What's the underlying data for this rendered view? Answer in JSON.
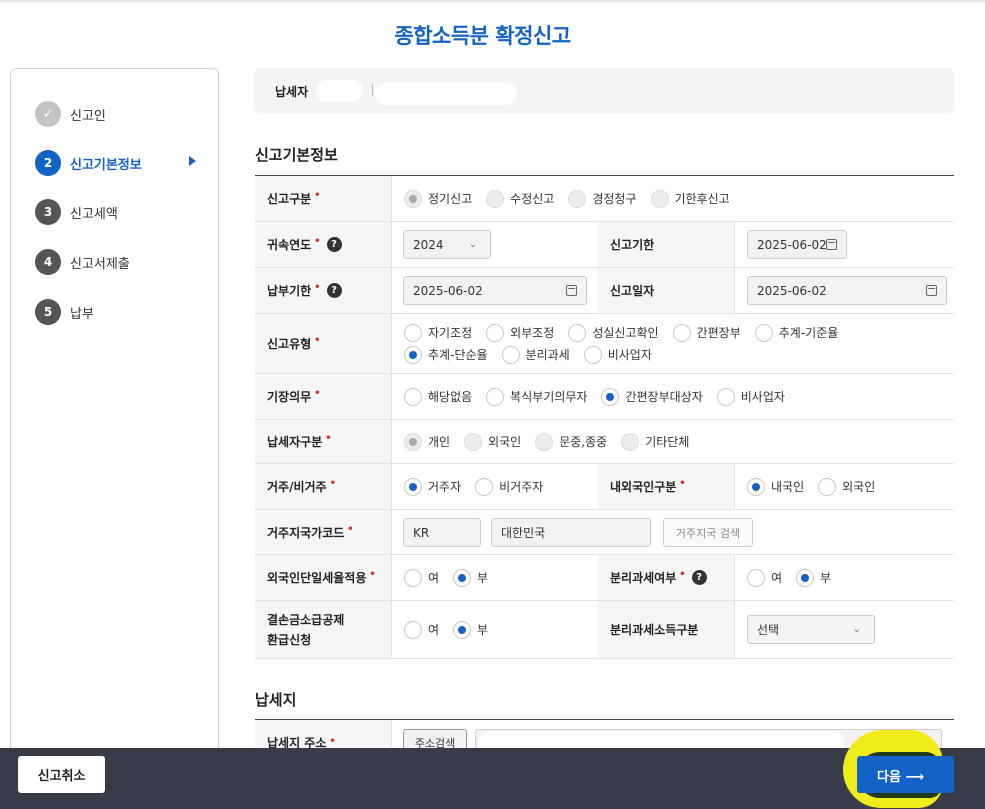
{
  "page": {
    "title": "종합소득분 확정신고"
  },
  "steps": [
    {
      "num": "✓",
      "label": "신고인",
      "state": "done"
    },
    {
      "num": "2",
      "label": "신고기본정보",
      "state": "active"
    },
    {
      "num": "3",
      "label": "신고세액",
      "state": "todo"
    },
    {
      "num": "4",
      "label": "신고서제출",
      "state": "todo"
    },
    {
      "num": "5",
      "label": "납부",
      "state": "todo"
    }
  ],
  "taxpayer": {
    "label": "납세자"
  },
  "basic": {
    "heading": "신고기본정보",
    "row1": {
      "label": "신고구분",
      "opts": [
        "정기신고",
        "수정신고",
        "경정청구",
        "기한후신고"
      ]
    },
    "row2": {
      "label": "귀속연도",
      "year": "2024",
      "label2": "신고기한",
      "deadline": "2025-06-02"
    },
    "row3": {
      "label": "납부기한",
      "pay_date": "2025-06-02",
      "label2": "신고일자",
      "report_date": "2025-06-02"
    },
    "row4": {
      "label": "신고유형",
      "opts": [
        "자기조정",
        "외부조정",
        "성실신고확인",
        "간편장부",
        "추계-기준율",
        "추계-단순율",
        "분리과세",
        "비사업자"
      ]
    },
    "row5": {
      "label": "기장의무",
      "opts": [
        "해당없음",
        "복식부기의무자",
        "간편장부대상자",
        "비사업자"
      ]
    },
    "row6": {
      "label": "납세자구분",
      "opts": [
        "개인",
        "외국인",
        "문중,종중",
        "기타단체"
      ]
    },
    "row7": {
      "label": "거주/비거주",
      "opts": [
        "거주자",
        "비거주자"
      ],
      "label2": "내외국인구분",
      "opts2": [
        "내국인",
        "외국인"
      ]
    },
    "row8": {
      "label": "거주지국가코드",
      "code": "KR",
      "country": "대한민국",
      "btn": "거주지국 검색"
    },
    "row9": {
      "label": "외국인단일세율적용",
      "opts": [
        "여",
        "부"
      ],
      "label2": "분리과세여부",
      "opts2": [
        "여",
        "부"
      ]
    },
    "row10": {
      "label1": "결손금소급공제",
      "label2": "환급신청",
      "opts": [
        "여",
        "부"
      ],
      "label3": "분리과세소득구분",
      "select": "선택"
    }
  },
  "addr": {
    "heading": "납세지",
    "label": "납세지 주소",
    "btn": "주소검색"
  },
  "footer": {
    "cancel": "신고취소",
    "next": "다음 ⟶"
  },
  "help": "?",
  "req": "•"
}
